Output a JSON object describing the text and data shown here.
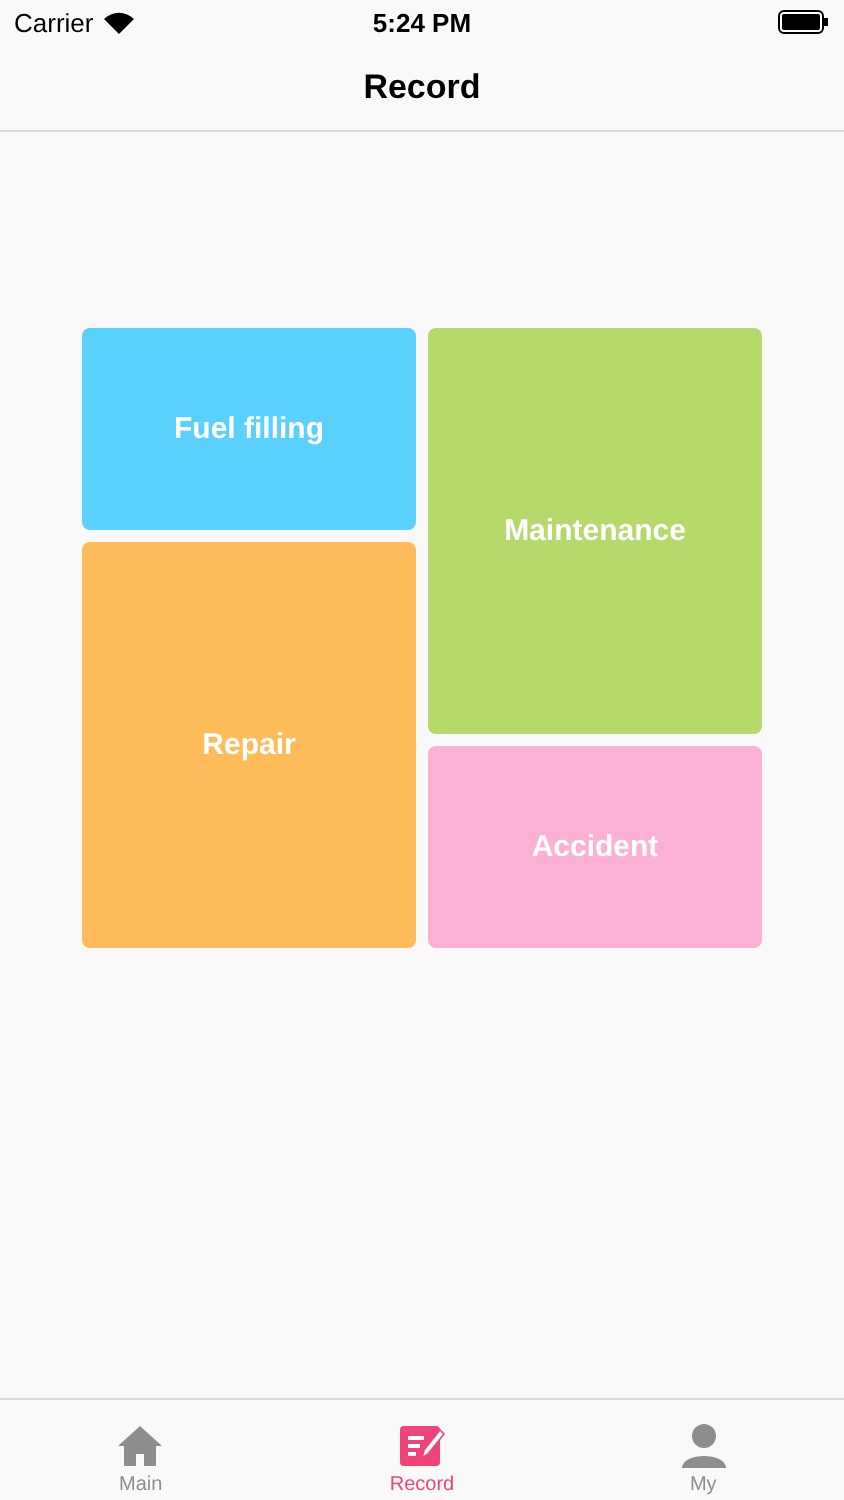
{
  "status_bar": {
    "carrier": "Carrier",
    "time": "5:24 PM"
  },
  "nav": {
    "title": "Record"
  },
  "tiles": [
    {
      "label": "Fuel filling",
      "color": "#5ad0fc"
    },
    {
      "label": "Maintenance",
      "color": "#b6d96b"
    },
    {
      "label": "Repair",
      "color": "#fdbb5a"
    },
    {
      "label": "Accident",
      "color": "#fcb0d5"
    }
  ],
  "tab_bar": [
    {
      "label": "Main",
      "kind": "home",
      "selected": false
    },
    {
      "label": "Record",
      "kind": "record",
      "selected": true
    },
    {
      "label": "My",
      "kind": "person",
      "selected": false
    }
  ]
}
